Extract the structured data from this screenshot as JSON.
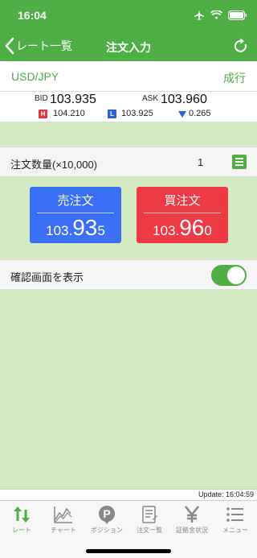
{
  "status": {
    "time": "16:04"
  },
  "nav": {
    "back_label": "レート一覧",
    "title": "注文入力"
  },
  "pair": {
    "symbol": "USD/JPY",
    "order_type": "成行"
  },
  "prices": {
    "bid_label": "BID",
    "bid": "103.935",
    "ask_label": "ASK",
    "ask": "103.960",
    "high_badge": "H",
    "high": "104.210",
    "low_badge": "L",
    "low": "103.925",
    "change": "0.265",
    "colors": {
      "high": "#e53340",
      "low": "#2b61d9",
      "down": "#2b61d9"
    }
  },
  "quantity": {
    "label": "注文数量(×10,000)",
    "value": "1"
  },
  "sell": {
    "label": "売注文",
    "price_a": "103.",
    "price_b": "93",
    "price_c": "5",
    "color": "#3b6ff5"
  },
  "buy": {
    "label": "買注文",
    "price_a": "103.",
    "price_b": "96",
    "price_c": "0",
    "color": "#ee3a45"
  },
  "confirm": {
    "label": "確認画面を表示",
    "enabled": true
  },
  "update": {
    "text": "Update: 16:04:59"
  },
  "tabs": [
    {
      "label": "レート",
      "icon": "rate-arrows-icon",
      "active": true
    },
    {
      "label": "チャート",
      "icon": "chart-icon",
      "active": false
    },
    {
      "label": "ポジション",
      "icon": "position-p-icon",
      "active": false
    },
    {
      "label": "注文一覧",
      "icon": "order-list-icon",
      "active": false
    },
    {
      "label": "証拠金状況",
      "icon": "yen-icon",
      "active": false
    },
    {
      "label": "メニュー",
      "icon": "menu-list-icon",
      "active": false
    }
  ],
  "accent": "#4fae45"
}
